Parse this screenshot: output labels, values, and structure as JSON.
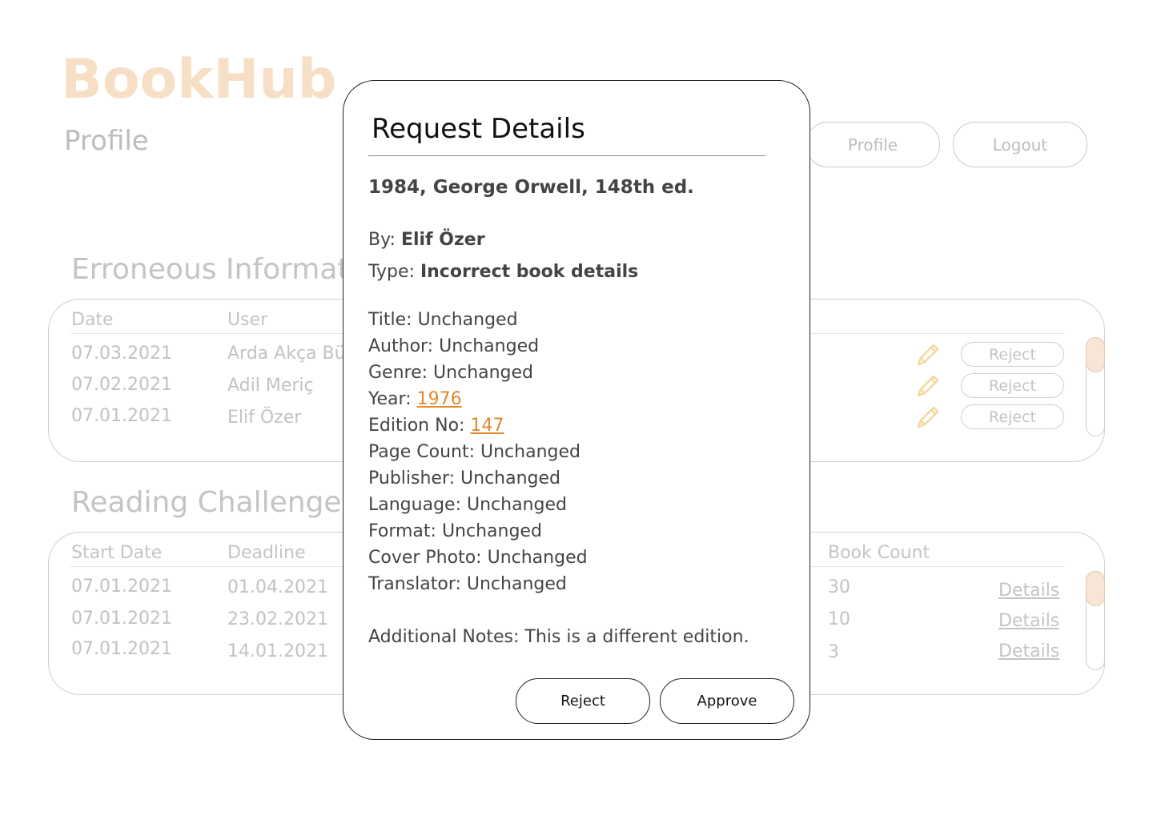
{
  "app": {
    "brand": "BookHub",
    "page_title": "Profile"
  },
  "nav": {
    "profile_label": "Profile",
    "logout_label": "Logout"
  },
  "erroneous": {
    "title": "Erroneous Informatio",
    "headers": {
      "date": "Date",
      "user": "User"
    },
    "rows": [
      {
        "date": "07.03.2021",
        "user": "Arda Akça Bü",
        "action": "Reject"
      },
      {
        "date": "07.02.2021",
        "user": "Adil Meriç",
        "action": "Reject"
      },
      {
        "date": "07.01.2021",
        "user": "Elif Özer",
        "action": "Reject"
      }
    ]
  },
  "challenges": {
    "title": "Reading Challenges",
    "headers": {
      "start": "Start Date",
      "deadline": "Deadline",
      "count": "Book Count"
    },
    "rows": [
      {
        "start": "07.01.2021",
        "deadline": "01.04.2021",
        "count": "30",
        "link": "Details"
      },
      {
        "start": "07.01.2021",
        "deadline": "23.02.2021",
        "count": "10",
        "link": "Details"
      },
      {
        "start": "07.01.2021",
        "deadline": "14.01.2021",
        "count": "3",
        "link": "Details"
      }
    ]
  },
  "modal": {
    "title": "Request Details",
    "book": "1984, George Orwell, 148th ed.",
    "by_label": "By:",
    "by_value": "Elif Özer",
    "type_label": "Type:",
    "type_value": "Incorrect book details",
    "fields": [
      {
        "label": "Title:",
        "value": "Unchanged",
        "changed": false
      },
      {
        "label": "Author:",
        "value": "Unchanged",
        "changed": false
      },
      {
        "label": "Genre:",
        "value": "Unchanged",
        "changed": false
      },
      {
        "label": "Year:",
        "value": "1976",
        "changed": true
      },
      {
        "label": "Edition No:",
        "value": "147",
        "changed": true
      },
      {
        "label": "Page Count:",
        "value": "Unchanged",
        "changed": false
      },
      {
        "label": "Publisher:",
        "value": "Unchanged",
        "changed": false
      },
      {
        "label": "Language:",
        "value": "Unchanged",
        "changed": false
      },
      {
        "label": "Format:",
        "value": "Unchanged",
        "changed": false
      },
      {
        "label": "Cover Photo:",
        "value": "Unchanged",
        "changed": false
      },
      {
        "label": "Translator:",
        "value": "Unchanged",
        "changed": false
      }
    ],
    "notes_label": "Additional Notes:",
    "notes_value": "This is a different edition.",
    "reject_label": "Reject",
    "approve_label": "Approve"
  },
  "colors": {
    "brand": "#f7dfc6",
    "accent": "#e08a2c",
    "scroll_thumb": "#f7e6d6"
  }
}
